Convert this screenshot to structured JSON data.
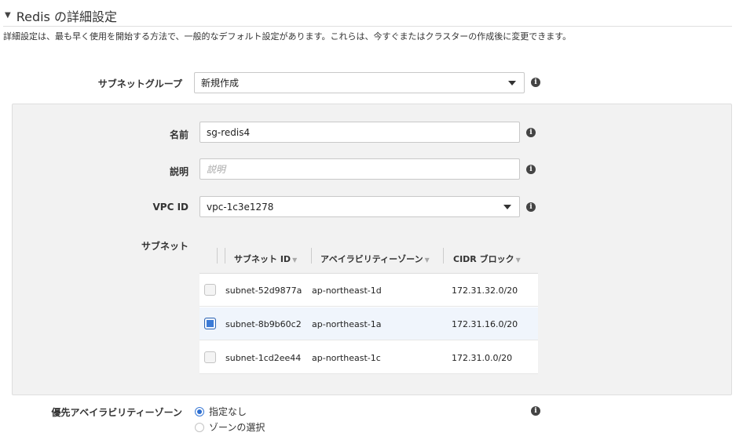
{
  "section": {
    "title": "Redis の詳細設定",
    "description": "詳細設定は、最も早く使用を開始する方法で、一般的なデフォルト設定があります。これらは、今すぐまたはクラスターの作成後に変更できます。"
  },
  "subnet_group": {
    "label": "サブネットグループ",
    "value": "新規作成"
  },
  "form": {
    "name_label": "名前",
    "name_value": "sg-redis4",
    "desc_label": "説明",
    "desc_placeholder": "説明",
    "vpc_label": "VPC ID",
    "vpc_value": "vpc-1c3e1278",
    "subnet_label": "サブネット"
  },
  "subnet_table": {
    "columns": [
      "サブネット ID",
      "アベイラビリティーゾーン",
      "CIDR ブロック"
    ],
    "rows": [
      {
        "id": "subnet-52d9877a",
        "az": "ap-northeast-1d",
        "cidr": "172.31.32.0/20",
        "checked": false
      },
      {
        "id": "subnet-8b9b60c2",
        "az": "ap-northeast-1a",
        "cidr": "172.31.16.0/20",
        "checked": true
      },
      {
        "id": "subnet-1cd2ee44",
        "az": "ap-northeast-1c",
        "cidr": "172.31.0.0/20",
        "checked": false
      }
    ]
  },
  "preferred_az": {
    "label": "優先アベイラビリティーゾーン",
    "options": [
      "指定なし",
      "ゾーンの選択"
    ],
    "selected": "指定なし"
  },
  "colors": {
    "accent": "#3b7ad6",
    "panel_bg": "#f2f2f2"
  },
  "icons": {
    "info": "info-icon",
    "caret": "caret-down-icon"
  }
}
